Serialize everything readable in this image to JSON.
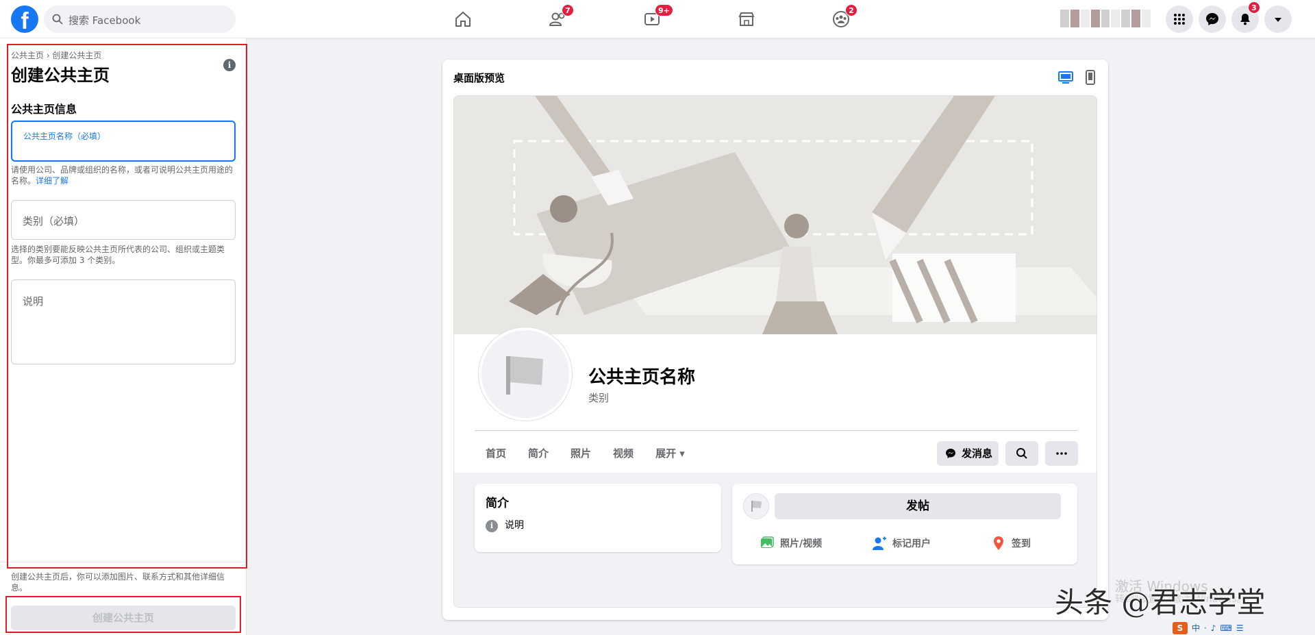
{
  "topbar": {
    "logo": "f",
    "search_placeholder": "搜索 Facebook",
    "badges": {
      "friends": "7",
      "watch": "9+",
      "groups": "2",
      "notifications": "3"
    }
  },
  "left_panel": {
    "breadcrumb": "公共主页 › 创建公共主页",
    "title": "创建公共主页",
    "section_title": "公共主页信息",
    "name_field_label": "公共主页名称（必填）",
    "name_help": "请使用公司、品牌或组织的名称，或者可说明公共主页用途的名称。",
    "learn_more": "详细了解",
    "category_placeholder": "类别（必填）",
    "category_help": "选择的类别要能反映公共主页所代表的公司、组织或主题类型。你最多可添加 3 个类别。",
    "description_placeholder": "说明",
    "footnote": "创建公共主页后，你可以添加图片、联系方式和其他详细信息。",
    "create_button": "创建公共主页"
  },
  "preview": {
    "title": "桌面版预览",
    "page_name": "公共主页名称",
    "category": "类别",
    "tabs": [
      "首页",
      "简介",
      "照片",
      "视频",
      "展开 ▾"
    ],
    "message_button": "发消息",
    "intro_title": "简介",
    "intro_item": "说明",
    "post_button": "发帖",
    "actions": [
      "照片/视频",
      "标记用户",
      "签到"
    ]
  },
  "overlay": {
    "windows_line1": "激活 Windows",
    "windows_line2": "转到\"设置\"以激活 Windows。",
    "watermark": "头条 @君志学堂",
    "tray": [
      "S",
      "中",
      "·",
      "♪",
      "⌨",
      "☰"
    ]
  },
  "colors": {
    "accent": "#1877f2",
    "badge": "#e41e3f",
    "highlight": "#e11d24"
  }
}
